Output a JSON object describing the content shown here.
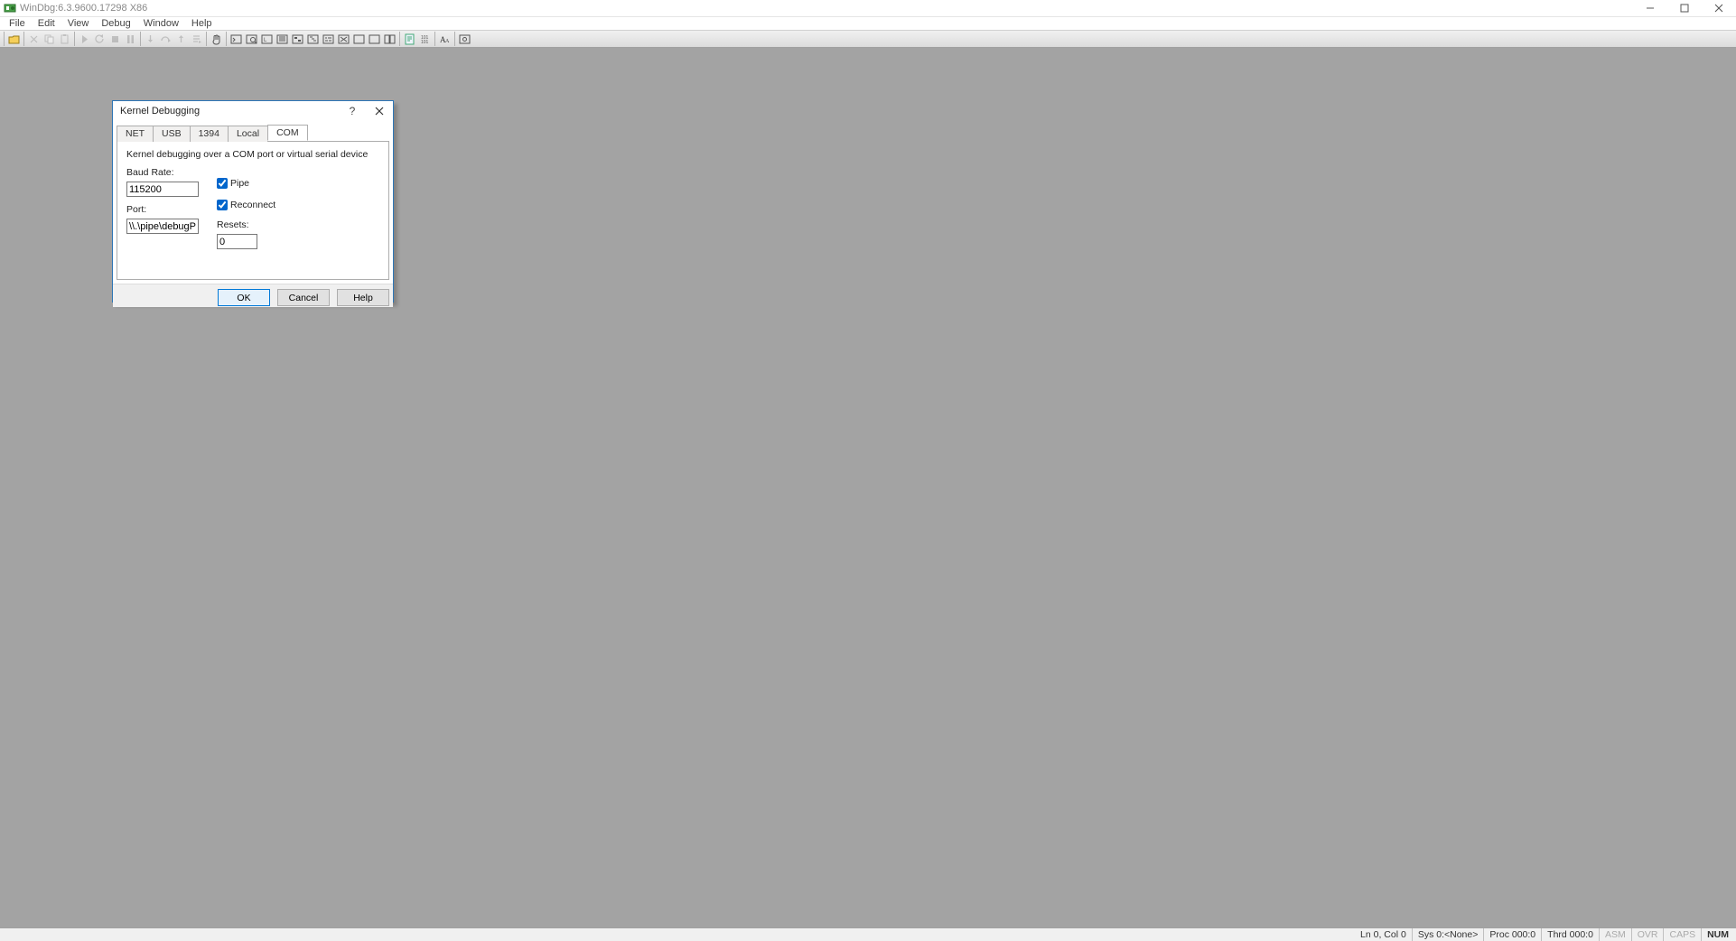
{
  "window": {
    "title": "WinDbg:6.3.9600.17298 X86"
  },
  "menu": {
    "items": [
      "File",
      "Edit",
      "View",
      "Debug",
      "Window",
      "Help"
    ]
  },
  "dialog": {
    "title": "Kernel Debugging",
    "tabs": [
      "NET",
      "USB",
      "1394",
      "Local",
      "COM"
    ],
    "active_tab": "COM",
    "description": "Kernel debugging over a COM port or virtual serial device",
    "baud_label": "Baud Rate:",
    "baud_value": "115200",
    "port_label": "Port:",
    "port_value": "\\\\.\\pipe\\debugPipe",
    "pipe_label": "Pipe",
    "reconnect_label": "Reconnect",
    "resets_label": "Resets:",
    "resets_value": "0",
    "buttons": {
      "ok": "OK",
      "cancel": "Cancel",
      "help": "Help"
    }
  },
  "status": {
    "ln_col": "Ln 0, Col 0",
    "sys": "Sys 0:<None>",
    "proc": "Proc 000:0",
    "thrd": "Thrd 000:0",
    "asm": "ASM",
    "ovr": "OVR",
    "caps": "CAPS",
    "num": "NUM"
  }
}
